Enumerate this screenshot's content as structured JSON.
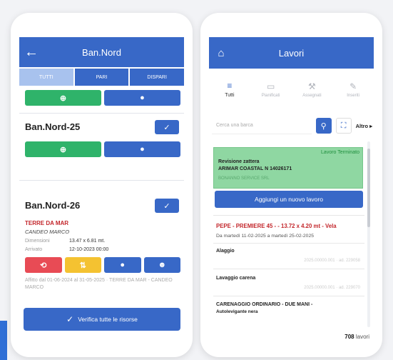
{
  "left": {
    "header": {
      "back_icon": "arrow-left-icon",
      "title": "Ban.Nord"
    },
    "filters": [
      "TUTTI",
      "PARI",
      "DISPARI"
    ],
    "cards": [
      {
        "name": "Ban.Nord-25"
      },
      {
        "name": "Ban.Nord-26",
        "boat": "TERRE DA MAR",
        "owner": "CANDEO MARCO",
        "dim_label": "Dimensioni",
        "dim_value": "13.47 x 6.81 mt.",
        "arrival_label": "Arrivato",
        "arrival_value": "12-10-2023 00:00",
        "note": "Affitto dal 01-06-2024 al 31-05-2025 · TERRE DA MAR - CANDEO MARCO"
      }
    ],
    "verify_label": "Verifica tutte le risorse"
  },
  "right": {
    "header": {
      "home_icon": "home-icon",
      "title": "Lavori"
    },
    "tabs": [
      {
        "label": "Tutti",
        "icon": "list-icon"
      },
      {
        "label": "Pianificati",
        "icon": "calendar-icon"
      },
      {
        "label": "Assegnati",
        "icon": "hammer-icon"
      },
      {
        "label": "Inseriti",
        "icon": "pen-icon"
      }
    ],
    "search_placeholder": "Cerca una barca",
    "more_label": "Altro",
    "done_job": {
      "status": "Lavoro Terminato",
      "title": "Revisione zattera",
      "boat": "ARIMAR COASTAL N 14026171",
      "company": "BONANNO SERVICE SRL"
    },
    "add_label": "Aggiungi un nuovo lavoro",
    "job": {
      "title": "PEPE - PREMIERE 45 - - 13.72 x 4.20 mt - Vela",
      "dates": "Da martedì 11-02-2025 a martedì 25-02-2025",
      "items": [
        {
          "name": "Alaggio",
          "meta": "2025.00000.001 · ad. 229058"
        },
        {
          "name": "Lavaggio carena",
          "meta": "2025.00000.001 · ad. 229070"
        },
        {
          "name": "CARENAGGIO ORDINARIO - DUE MANI -",
          "sub": "Autolevigante nera"
        }
      ]
    },
    "count_value": "708",
    "count_label": "lavori"
  },
  "colors": {
    "primary": "#3868c7",
    "success": "#2fb36a",
    "danger": "#e84b55",
    "warning": "#f4c231"
  }
}
